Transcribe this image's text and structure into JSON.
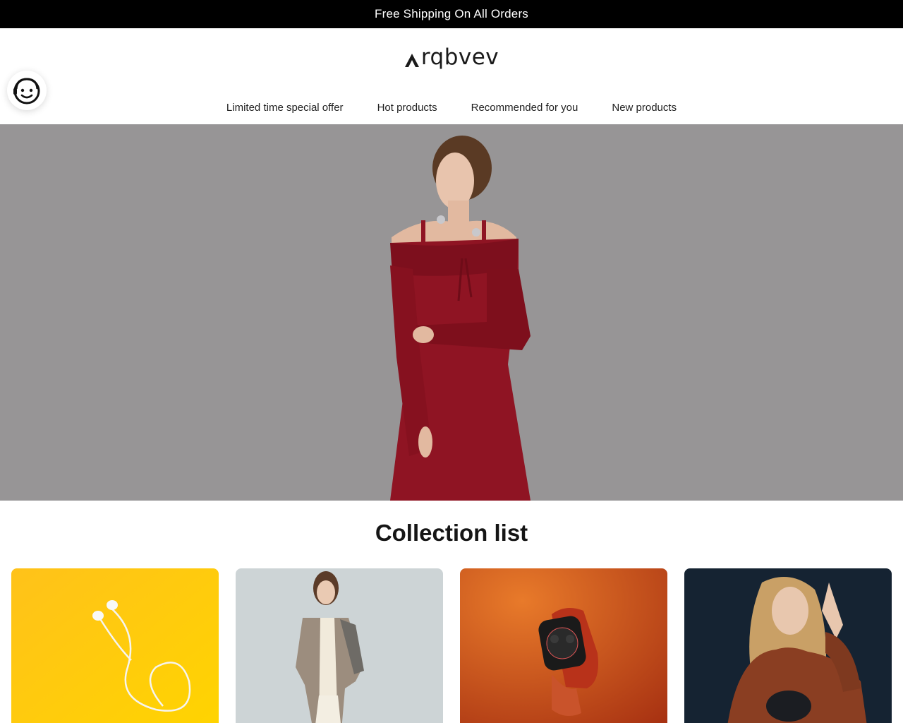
{
  "announcement": {
    "text": "Free Shipping On All Orders"
  },
  "brand": {
    "name": "rqbvev"
  },
  "nav": {
    "items": [
      {
        "label": "Limited time special offer"
      },
      {
        "label": "Hot products"
      },
      {
        "label": "Recommended for you"
      },
      {
        "label": "New products"
      }
    ]
  },
  "hero": {
    "image": "woman-red-off-shoulder-dress-photo"
  },
  "collection": {
    "title": "Collection list",
    "cards": [
      {
        "image": "white-earphones-on-yellow"
      },
      {
        "image": "woman-in-beige-blazer"
      },
      {
        "image": "smartwatch-on-orange"
      },
      {
        "image": "woman-in-brown-sweater-with-bag"
      }
    ]
  },
  "colors": {
    "announcement_bg": "#000000",
    "hero_bg": "#979596",
    "dress": "#8f1423"
  },
  "support": {
    "icon": "customer-service-face-icon"
  }
}
